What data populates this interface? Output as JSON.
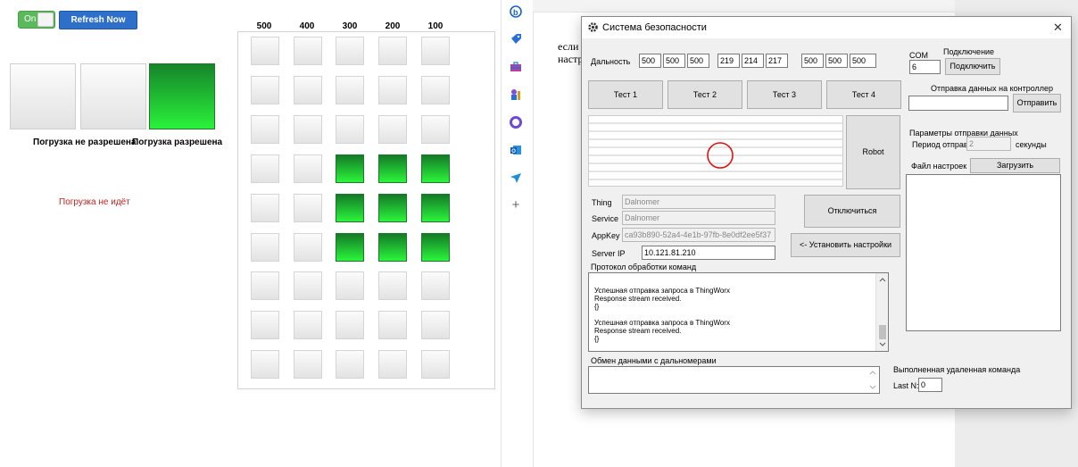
{
  "dashboard": {
    "toggle_label": "On",
    "refresh_label": "Refresh Now",
    "caption_denied": "Погрузка не разрешена",
    "caption_allowed": "Погрузка разрешена",
    "status": "Погрузка не идёт",
    "columns": [
      "500",
      "400",
      "300",
      "200",
      "100"
    ],
    "grid": [
      [
        0,
        0,
        0,
        0,
        0
      ],
      [
        0,
        0,
        0,
        0,
        0
      ],
      [
        0,
        0,
        0,
        0,
        0
      ],
      [
        0,
        0,
        1,
        1,
        1
      ],
      [
        0,
        0,
        1,
        1,
        1
      ],
      [
        0,
        0,
        1,
        1,
        1
      ],
      [
        0,
        0,
        0,
        0,
        0
      ],
      [
        0,
        0,
        0,
        0,
        0
      ],
      [
        0,
        0,
        0,
        0,
        0
      ]
    ]
  },
  "background_doc": {
    "line1": "если",
    "line2": "настр"
  },
  "dialog": {
    "title": "Система безопасности",
    "close_glyph": "✕",
    "range_label": "Дальность",
    "range_values": [
      "500",
      "500",
      "500",
      "219",
      "214",
      "217",
      "500",
      "500",
      "500"
    ],
    "com_label": "COM",
    "com_value": "6",
    "connect_label": "Подключение",
    "connect_button": "Подключить",
    "send_label": "Отправка данных на контроллер",
    "send_button": "Отправить",
    "tests": [
      "Тест 1",
      "Тест 2",
      "Тест 3",
      "Тест 4"
    ],
    "robot_button": "Robot",
    "params_label": "Параметры отправки данных",
    "period_label": "Период отправки",
    "period_value": "2",
    "period_unit": "секунды",
    "settings_file_label": "Файл настроек",
    "load_button": "Загрузить",
    "thing_label": "Thing",
    "thing_value": "Dalnomer",
    "service_label": "Service",
    "service_value": "Dalnomer",
    "appkey_label": "AppKey",
    "appkey_value": "ca93b890-52a4-4e1b-97fb-8e0df2ee5f37",
    "serverip_label": "Server IP",
    "serverip_value": "10.121.81.210",
    "disconnect_button": "Отключиться",
    "apply_button": "<- Установить настройки",
    "protocol_label": "Протокол обработки команд",
    "log": [
      "Успешная отправка запроса в ThingWorx",
      "Response stream received.",
      "{}",
      "",
      "Успешная отправка запроса в ThingWorx",
      "Response stream received.",
      "{}"
    ],
    "exchange_label": "Обмен данными с дальномерами",
    "remote_label": "Выполненная удаленная команда",
    "lastn_label": "Last N:",
    "lastn_value": "0"
  }
}
